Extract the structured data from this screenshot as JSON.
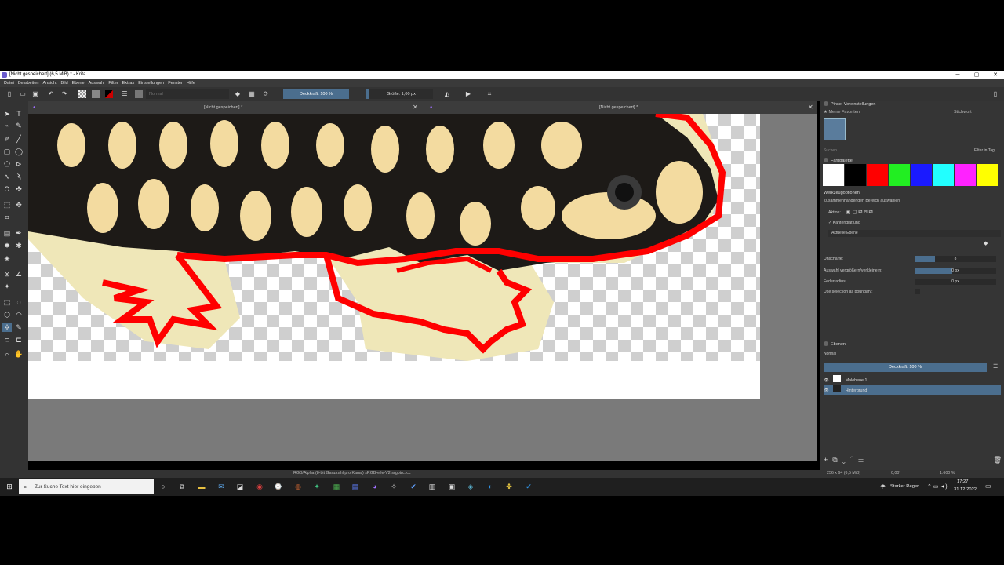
{
  "window": {
    "title": "[Nicht gespeichert]  (6,5 MiB)  * - Krita",
    "controls": [
      "─",
      "▢",
      "✕"
    ]
  },
  "menu": [
    "Datei",
    "Bearbeiten",
    "Ansicht",
    "Bild",
    "Ebene",
    "Auswahl",
    "Filter",
    "Extras",
    "Einstellungen",
    "Fenster",
    "Hilfe"
  ],
  "toolbar": {
    "blend_mode": "Normal",
    "opacity": "Deckkraft: 100 %",
    "size": "Größe: 1,00 px"
  },
  "tabs": [
    "[Nicht gespeichert] *",
    "[Nicht gespeichert] *"
  ],
  "dockers": {
    "brush_presets": {
      "title": "Pinsel-Voreinstellungen",
      "favorites": "Meine Favoriten",
      "tag_button": "Stichwort",
      "search_placeholder": "Suchen",
      "filter_in_tag": "Filter in Tag"
    },
    "palette": {
      "title": "Farbpalette",
      "colors": [
        "#ffffff",
        "#000000",
        "#ff0000",
        "#22ee22",
        "#1a1aff",
        "#22ffff",
        "#ff22ff",
        "#ffff00"
      ]
    },
    "tool_options": {
      "title": "Werkzeugoptionen",
      "subtitle": "Zusammenhängenden Bereich auswählen",
      "action_label": "Aktion:",
      "antialias": "Kantenglättung",
      "layer_source": "Aktuelle Ebene",
      "fuzziness_label": "Unschärfe:",
      "fuzziness_value": "8",
      "fuzziness_fraction": 0.25,
      "grow_label": "Auswahl vergrößern/verkleinern:",
      "grow_value": "0 px",
      "feather_label": "Federradius:",
      "feather_value": "0 px",
      "boundary_label": "Use selection as boundary:"
    },
    "layers": {
      "title": "Ebenen",
      "blend": "Normal",
      "opacity": "Deckkraft: 100 %",
      "items": [
        {
          "name": "Malebene 1",
          "selected": false
        },
        {
          "name": "Hintergrund",
          "selected": true
        }
      ]
    }
  },
  "status": {
    "color_info": "RGB/Alpha (8-bit Ganzzahl pro Kanal)  sRGB-elle-V2-srgbtrc.icc",
    "doc_size": "256 x 64 (6,5 MiB)",
    "rotation": "0,00°",
    "zoom": "1.600 %"
  },
  "taskbar": {
    "search_placeholder": "Zur Suche Text hier eingeben",
    "weather": "Starker Regen",
    "time": "17:27",
    "date": "31.12.2022"
  }
}
